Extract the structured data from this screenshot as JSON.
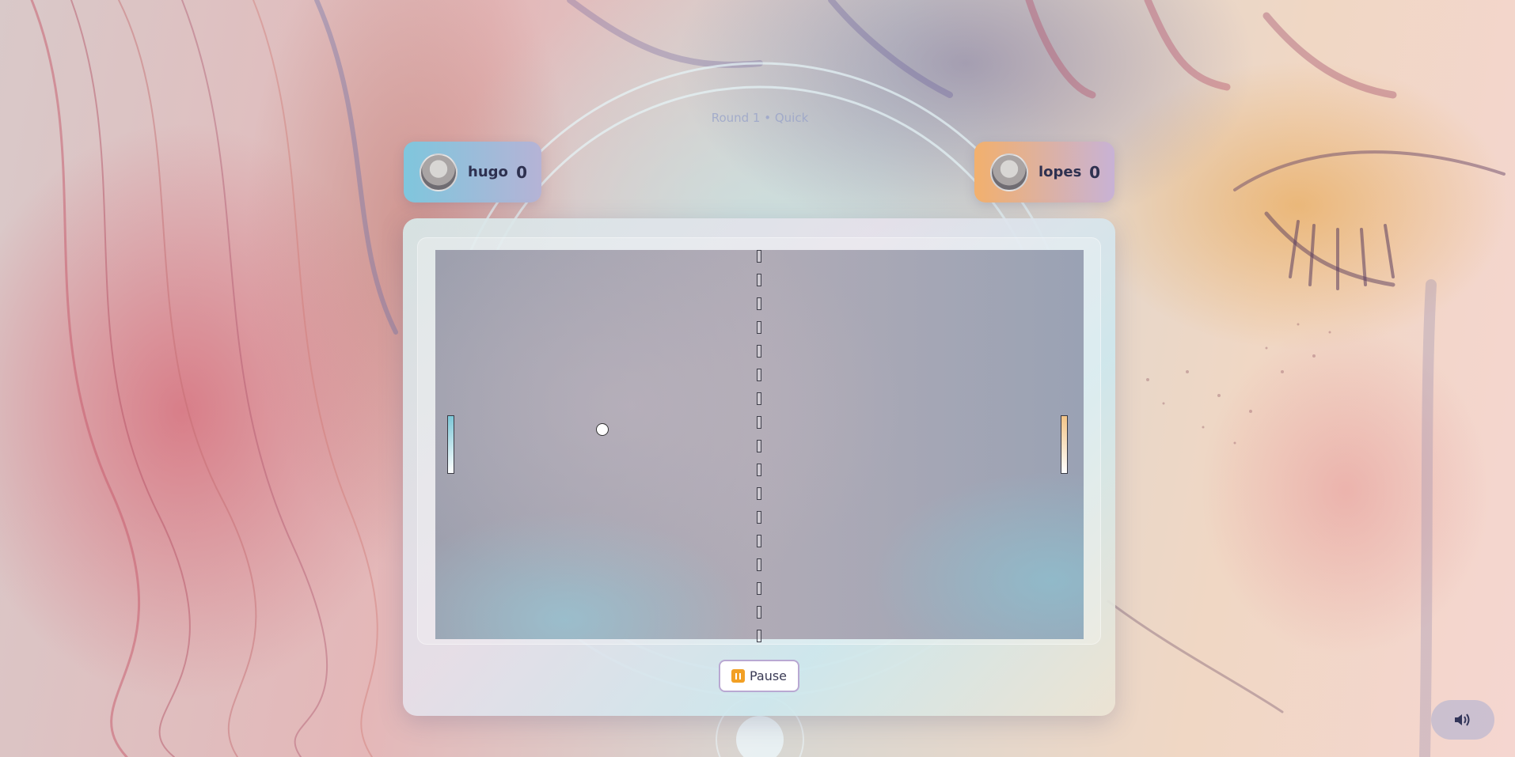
{
  "match": {
    "round_label": "Round 1 • Quick"
  },
  "players": [
    {
      "name": "hugo",
      "score": "0",
      "accent": "#7fc6dd"
    },
    {
      "name": "lopes",
      "score": "0",
      "accent": "#f2b06d"
    }
  ],
  "controls": {
    "pause_label": "Pause",
    "sound_icon": "speaker-icon"
  },
  "colors": {
    "pause_icon": "#f2a024",
    "pause_border": "#b9a8d2",
    "text": "#2e3150"
  }
}
